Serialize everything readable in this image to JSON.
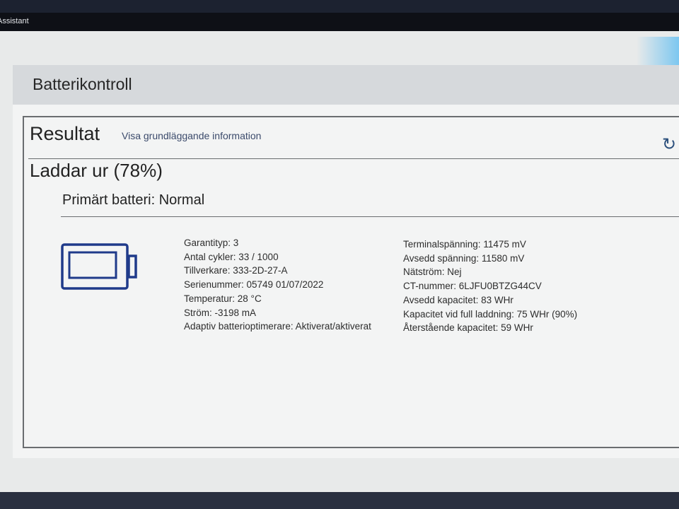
{
  "window": {
    "title": "Assistant"
  },
  "page": {
    "title": "Batterikontroll"
  },
  "result": {
    "title": "Resultat",
    "basic_info_link": "Visa grundläggande information",
    "refresh_icon": "refresh-icon",
    "status": "Laddar ur (78%)",
    "charge_level_percent": 78
  },
  "battery": {
    "title": "Primärt batteri: Normal",
    "icon": "battery-icon",
    "icon_color": "#1f3a8a",
    "left_details": [
      "Garantityp: 3",
      "Antal cykler: 33 / 1000",
      "Tillverkare: 333-2D-27-A",
      "Serienummer: 05749 01/07/2022",
      "Temperatur: 28 °C",
      "Ström: -3198 mA",
      "Adaptiv batterioptimerare: Aktiverat/aktiverat"
    ],
    "right_details": [
      "Terminalspänning: 11475 mV",
      "Avsedd spänning: 11580 mV",
      "Nätström: Nej",
      "CT-nummer: 6LJFU0BTZG44CV",
      "Avsedd kapacitet: 83 WHr",
      "Kapacitet vid full laddning: 75 WHr (90%)",
      "Återstående kapacitet: 59 WHr"
    ]
  }
}
